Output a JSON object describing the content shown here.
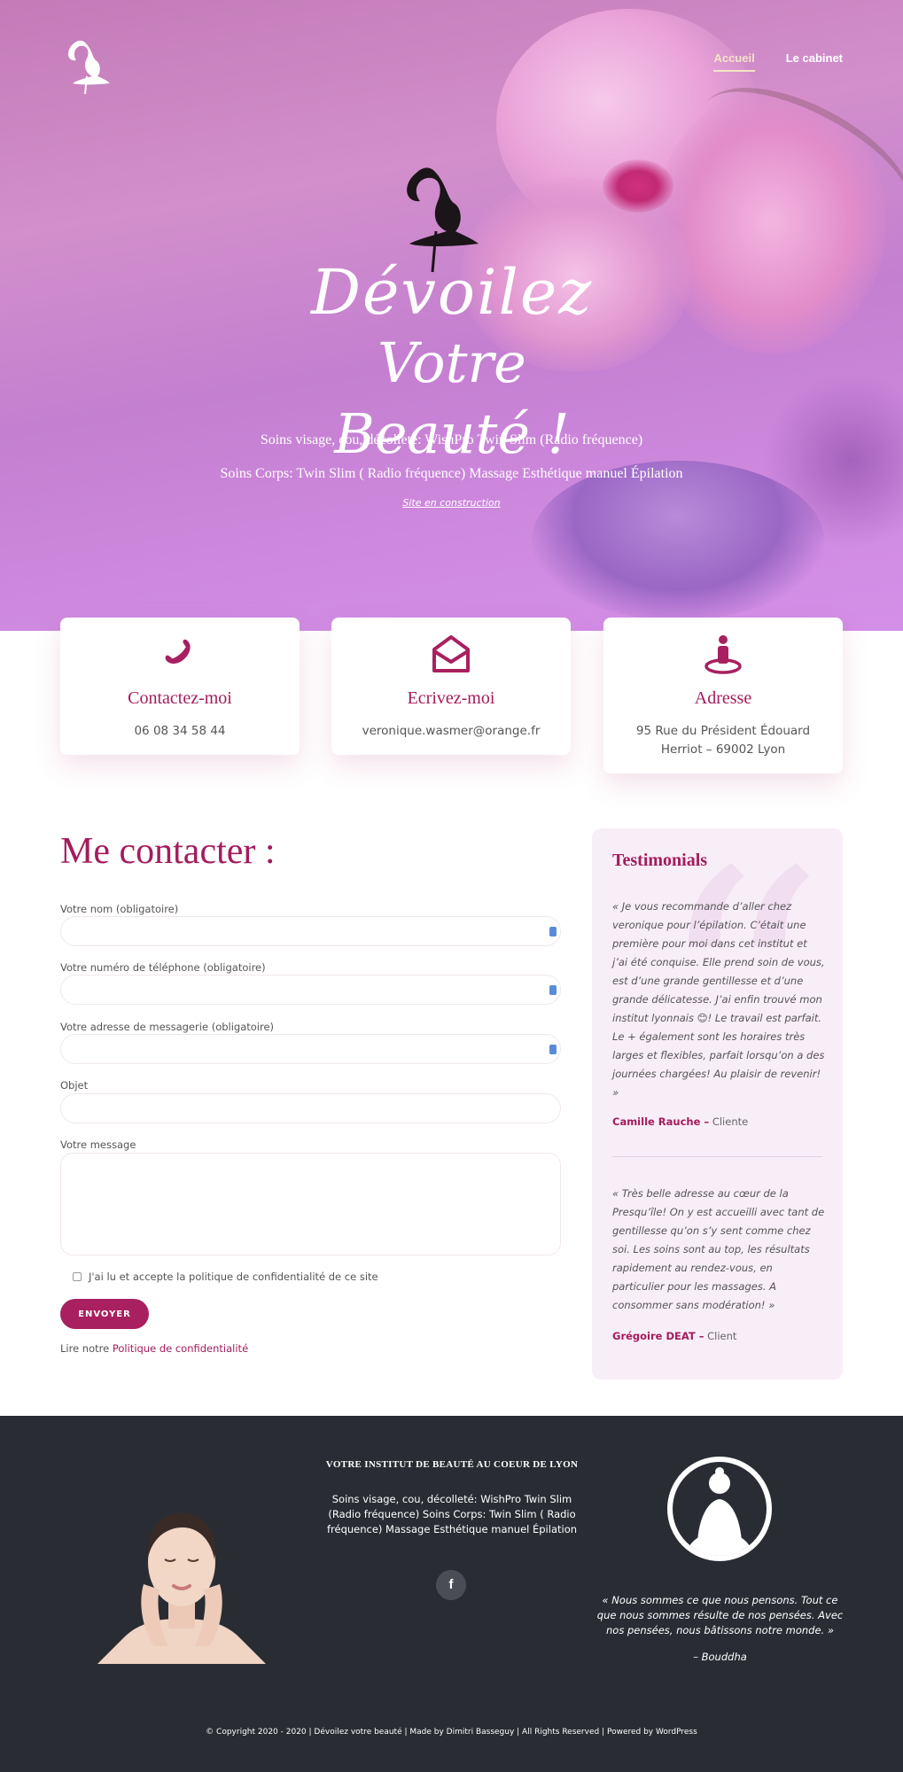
{
  "nav": {
    "items": [
      {
        "label": "Accueil",
        "active": true
      },
      {
        "label": "Le cabinet",
        "active": false
      }
    ]
  },
  "hero": {
    "script_line1": "Dévoilez",
    "script_line2": "Votre Beauté !",
    "line1": "Soins visage, cou, décolleté: WishPro Twin Slim (Radio fréquence)",
    "line2": "Soins Corps: Twin Slim ( Radio fréquence) Massage Esthétique manuel Épilation",
    "link": "Site en construction"
  },
  "cards": [
    {
      "icon": "phone-icon",
      "title": "Contactez-moi",
      "value": "06 08 34 58 44"
    },
    {
      "icon": "envelope-icon",
      "title": "Ecrivez-moi",
      "value": "veronique.wasmer@orange.fr"
    },
    {
      "icon": "location-person-icon",
      "title": "Adresse",
      "value": "95 Rue du Président Édouard Herriot – 69002 Lyon"
    }
  ],
  "form": {
    "title": "Me contacter :",
    "name_label": "Votre nom (obligatoire)",
    "phone_label": "Votre numéro de téléphone (obligatoire)",
    "email_label": "Votre adresse de messagerie (obligatoire)",
    "subject_label": "Objet",
    "message_label": "Votre message",
    "consent": "J'ai lu et accepte la politique de confidentialité de ce site",
    "submit": "ENVOYER",
    "policy_prefix": "Lire notre ",
    "policy_link": "Politique de confidentialité"
  },
  "testimonials": {
    "title": "Testimonials",
    "items": [
      {
        "text": "« Je vous recommande d’aller chez veronique pour l’épilation. C’était une première pour moi dans cet institut et j’ai été conquise. Elle prend soin de vous, est d’une grande gentillesse et d’une grande délicatesse. J’ai enfin trouvé mon institut lyonnais 😊! Le travail est parfait. Le + également sont les horaires très larges et flexibles, parfait lorsqu’on a des journées chargées! Au plaisir de revenir! »",
        "author": "Camille Rauche –",
        "role": " Cliente"
      },
      {
        "text": "« Très belle adresse au cœur de la Presqu’île! On y est accueilli avec tant de gentillesse qu’on s’y sent comme chez soi. Les soins sont au top, les résultats rapidement au rendez-vous, en particulier pour les massages. A consommer sans modération! »",
        "author": "Grégoire DEAT –",
        "role": " Client"
      }
    ]
  },
  "footer": {
    "title": "VOTRE INSTITUT DE BEAUTÉ AU COEUR DE LYON",
    "text": "Soins visage, cou, décolleté: WishPro Twin Slim (Radio fréquence) Soins Corps: Twin Slim ( Radio fréquence) Massage Esthétique manuel Épilation",
    "social": "f",
    "quote": "« Nous sommes ce que nous pensons. Tout ce que nous sommes résulte de nos pensées. Avec nos pensées, nous bâtissons notre monde. »",
    "quote_author": "– Bouddha",
    "copyright": "© Copyright 2020 - 2020 | Dévoilez votre beauté | Made by Dimitri Basseguy | All Rights Reserved | Powered by WordPress"
  },
  "colors": {
    "accent": "#a31c5c",
    "button": "#a8205f",
    "footer_bg": "#292d33",
    "testimonial_bg": "#f8eef8"
  }
}
